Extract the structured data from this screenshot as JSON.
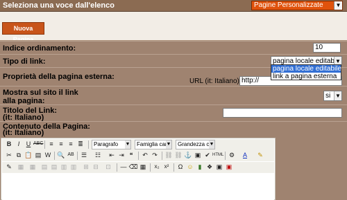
{
  "header": {
    "title": "Seleziona una voce dall'elenco",
    "selector_value": "Pagine Personalizzate"
  },
  "new_page_button": "Nuova Pagina",
  "form": {
    "order_label": "Indice ordinamento:",
    "order_value": "10",
    "link_type_label": "Tipo di link:",
    "link_type_value": "pagina locale editabile",
    "link_type_options": [
      "pagina locale editabile",
      "link a pagina esterna"
    ],
    "external_label": "Proprietà della pagina esterna:",
    "url_label": "URL (it: Italiano):",
    "url_value": "http://",
    "show_link_label": "Mostra sul sito il link alla pagina:",
    "show_link_value": "si",
    "link_title_label": "Titolo del Link:",
    "link_title_lang": "(it: Italiano)",
    "content_label": "Contenuto della Pagina:",
    "content_lang": "(it: Italiano)"
  },
  "editor": {
    "paragraph_combo": "Paragrafo",
    "font_combo": "Famiglia caratt",
    "size_combo": "Grandezza car"
  }
}
